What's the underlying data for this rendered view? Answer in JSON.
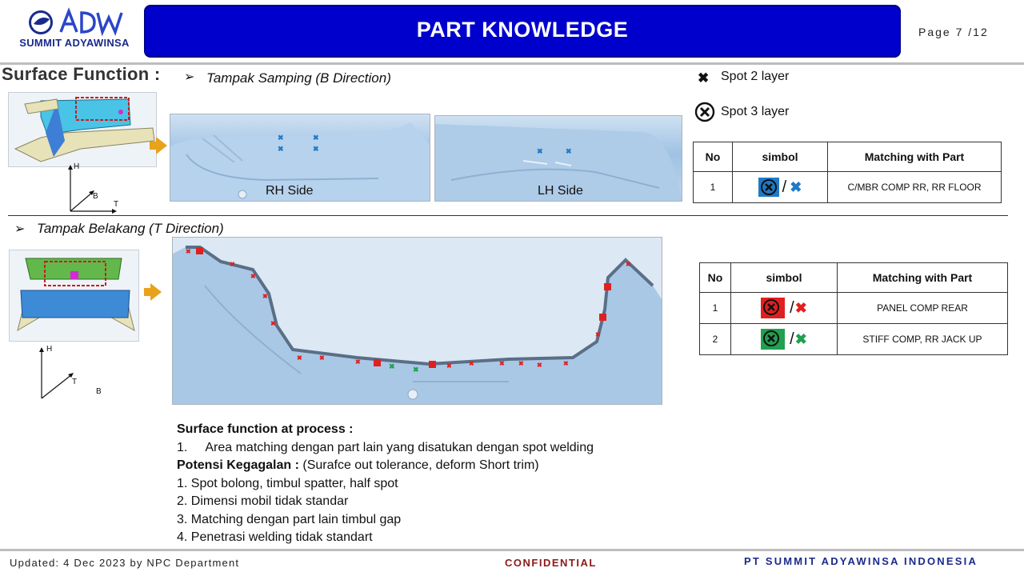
{
  "header": {
    "logo_text": "SUMMIT ADYAWINSA",
    "title": "PART KNOWLEDGE",
    "page": "Page  7 /12"
  },
  "section": {
    "heading": "Surface   Function :",
    "bullet_b": "Tampak Samping (B Direction)",
    "bullet_t": "Tampak Belakang (T Direction)",
    "rh_label": "RH Side",
    "lh_label": "LH Side",
    "axes_b": {
      "h": "H",
      "b": "B",
      "t": "T"
    },
    "axes_t": {
      "h": "H",
      "t": "T",
      "b": "B"
    }
  },
  "legend": {
    "spot2": "Spot 2 layer",
    "spot3": "Spot 3 layer"
  },
  "table1": {
    "headers": [
      "No",
      "simbol",
      "Matching with Part"
    ],
    "rows": [
      {
        "no": "1",
        "part": "C/MBR COMP RR, RR FLOOR",
        "color": "#1f7ac8"
      }
    ]
  },
  "table2": {
    "headers": [
      "No",
      "simbol",
      "Matching with Part"
    ],
    "rows": [
      {
        "no": "1",
        "part": "PANEL COMP REAR",
        "color": "#e02020"
      },
      {
        "no": "2",
        "part": "STIFF COMP, RR JACK UP",
        "color": "#20a050"
      }
    ]
  },
  "process": {
    "title": "Surface function at process   :",
    "item1_no": "1.",
    "item1": "Area matching dengan part lain yang disatukan dengan spot welding",
    "potensi_label": "Potensi Kegagalan :",
    "potensi_text": " (Surafce out tolerance, deform Short trim)",
    "list": [
      "1. Spot bolong, timbul spatter, half spot",
      "2. Dimensi mobil tidak standar",
      "3. Matching dengan part lain timbul gap",
      "4. Penetrasi welding tidak standart"
    ]
  },
  "footer": {
    "updated": "Updated: 4 Dec 2023 by NPC Department",
    "confidential": "CONFIDENTIAL",
    "company": "PT SUMMIT ADYAWINSA INDONESIA"
  }
}
